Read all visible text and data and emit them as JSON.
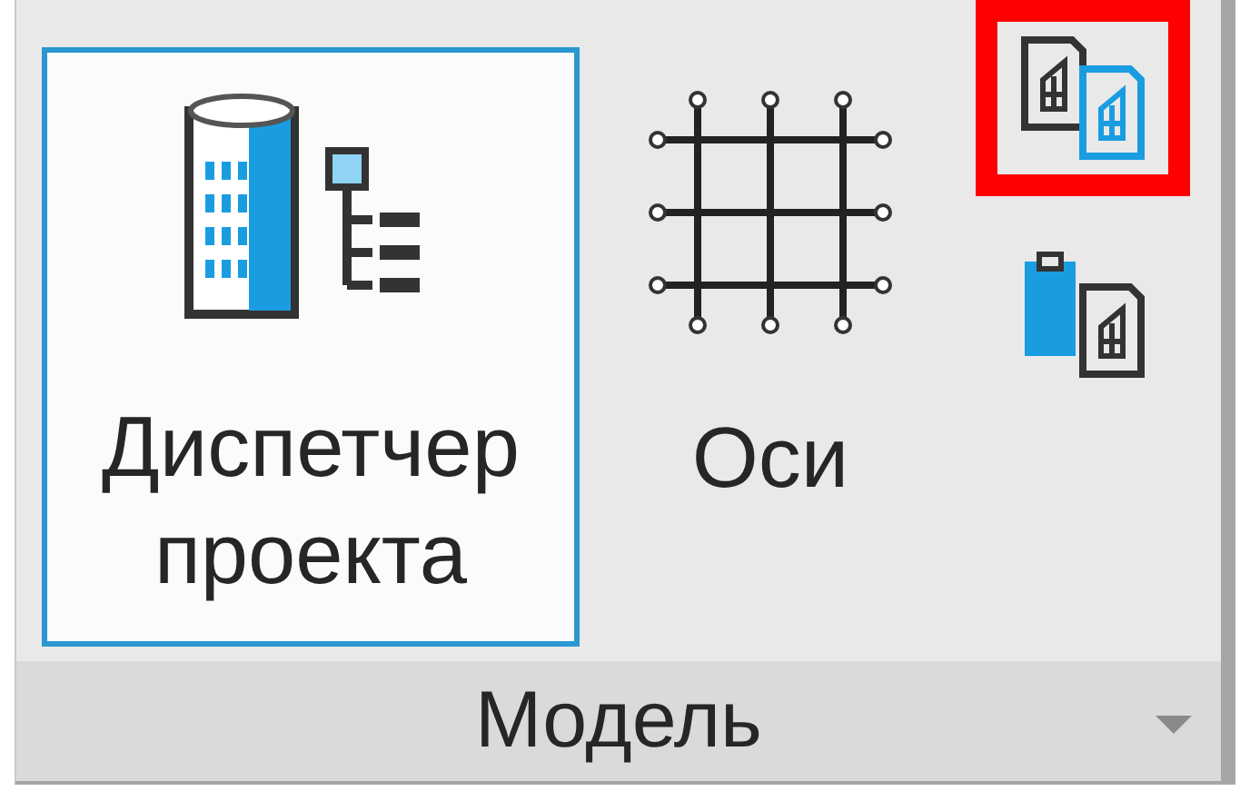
{
  "panel": {
    "title": "Модель",
    "large_buttons": [
      {
        "kind": "manager",
        "label": "Диспетчер проекта",
        "selected": true
      },
      {
        "kind": "grid",
        "label": "Оси",
        "selected": false
      }
    ],
    "small_buttons": [
      {
        "kind": "copy",
        "highlighted": true
      },
      {
        "kind": "paste",
        "highlighted": false
      }
    ]
  }
}
